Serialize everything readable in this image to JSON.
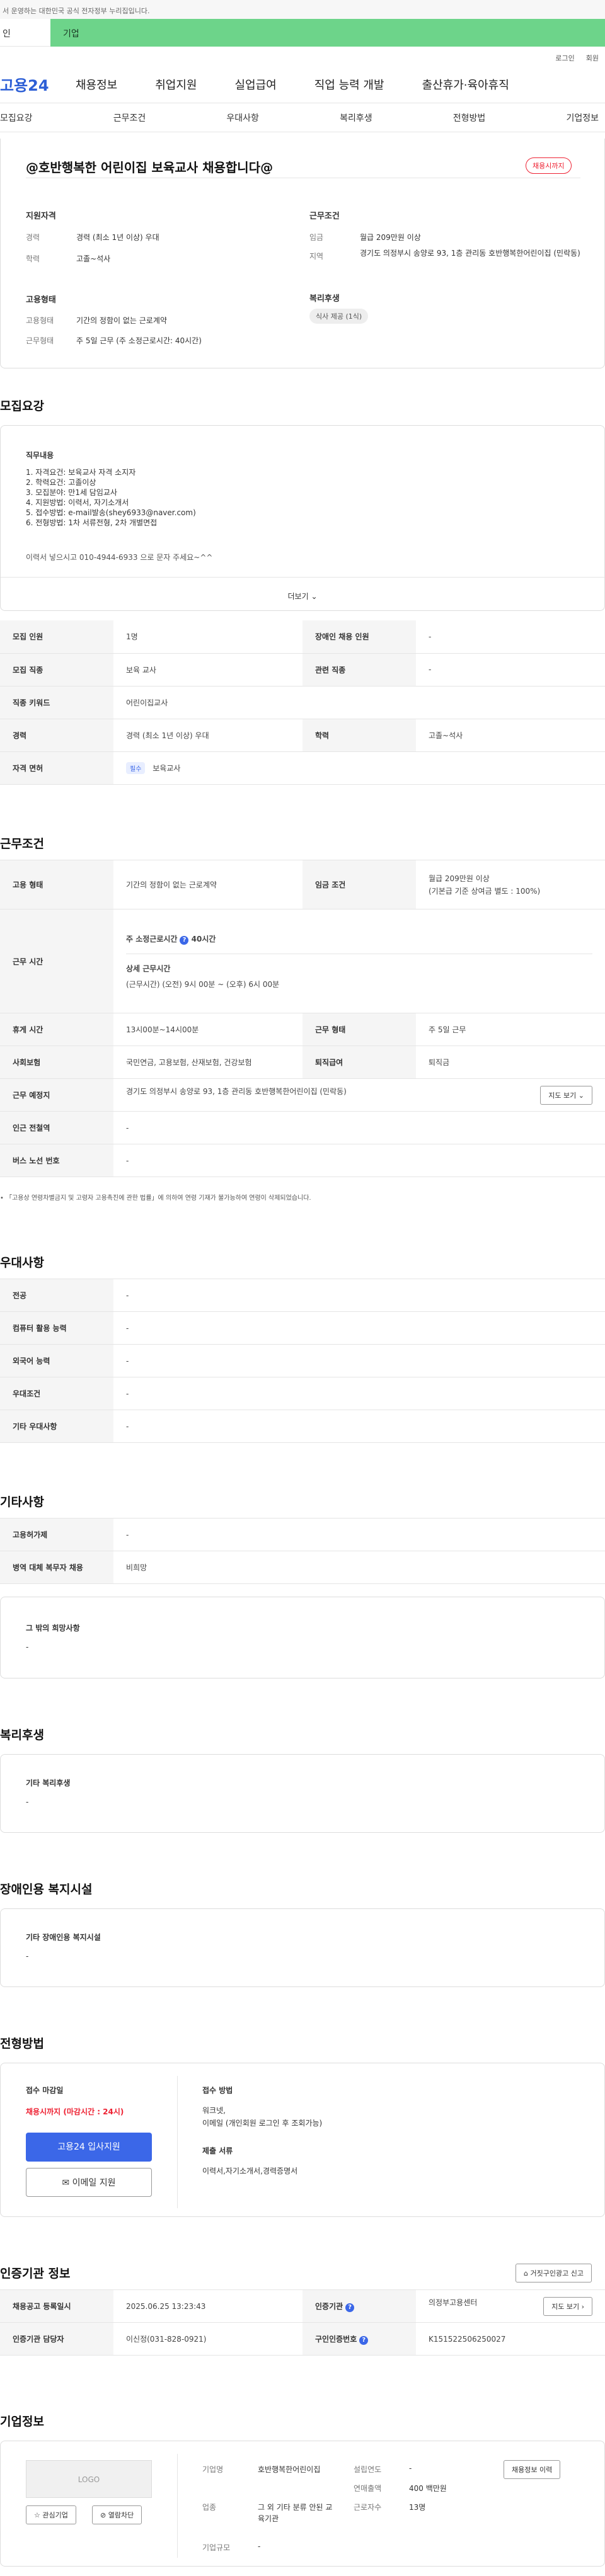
{
  "top_notice": "서 운영하는 대한민국 공식 전자정부 누리집입니다.",
  "member_tabs": [
    "인",
    "기업"
  ],
  "util": [
    "로그인",
    "회원"
  ],
  "logo": "고용24",
  "gnb": [
    "채용정보",
    "취업지원",
    "실업급여",
    "직업 능력 개발",
    "출산휴가·육아휴직"
  ],
  "subnav": [
    "모집요강",
    "근무조건",
    "우대사항",
    "복리후생",
    "전형방법",
    "기업정보"
  ],
  "header": {
    "title": "@호반행복한 어린이집 보육교사 채용합니다@",
    "status_badge": "채용시까지",
    "qual_title": "지원자격",
    "qual": [
      {
        "k": "경력",
        "v": "경력 (최소 1년 이상) 우대"
      },
      {
        "k": "학력",
        "v": "고졸~석사"
      }
    ],
    "cond_title": "근무조건",
    "cond": [
      {
        "k": "임금",
        "v": "월급 209만원 이상"
      },
      {
        "k": "지역",
        "v": "경기도 의정부시 송양로 93, 1층 관리동 호반행복한어린이집 (민락동)"
      }
    ],
    "emp_title": "고용형태",
    "emp": [
      {
        "k": "고용형태",
        "v": "기간의 정함이 없는 근로계약"
      },
      {
        "k": "근무형태",
        "v": "주 5일 근무 (주 소정근로시간: 40시간)"
      }
    ],
    "welfare_title": "복리후생",
    "welfare_chip": "식사 제공 (1식)"
  },
  "recruit": {
    "section_title": "모집요강",
    "duty_title": "직무내용",
    "duty_lines": [
      "1. 자격요건: 보육교사 자격 소지자",
      "2. 학력요건: 고졸이상",
      "3. 모집분야: 만1세 담임교사",
      "4. 지원방법: 이력서, 자기소개서",
      "5. 접수방법: e-mail발송(shey6933@naver.com)",
      "6. 전형방법: 1차 서류전형, 2차 개별면접"
    ],
    "duty_extra": "이력서 넣으시고 010-4944-6933 으로 문자 주세요~^^",
    "more": "더보기",
    "rows": [
      [
        {
          "h": "모집 인원",
          "v": "1명"
        },
        {
          "h": "장애인 채용 인원",
          "v": "-"
        }
      ],
      [
        {
          "h": "모집 직종",
          "v": "보육 교사"
        },
        {
          "h": "관련 직종",
          "v": "-"
        }
      ],
      [
        {
          "h": "직종 키워드",
          "v": "어린이집교사"
        }
      ],
      [
        {
          "h": "경력",
          "v": "경력 (최소 1년 이상) 우대"
        },
        {
          "h": "학력",
          "v": "고졸~석사"
        }
      ]
    ],
    "license_h": "자격 면허",
    "license_chip": "필수",
    "license_v": "보육교사"
  },
  "work": {
    "section_title": "근무조건",
    "emp_h": "고용 형태",
    "emp_v": "기간의 정함이 없는 근로계약",
    "wage_h": "임금 조건",
    "wage_v1": "월급 209만원 이상",
    "wage_v2": "(기본급 기준 상여금 별도 : 100%)",
    "hours_h": "근무 시간",
    "hours_main_label": "주 소정근로시간",
    "hours_main_value": "40시간",
    "hours_detail_title": "상세 근무시간",
    "hours_detail": "(근무시간) (오전) 9시 00분 ~ (오후) 6시 00분",
    "break_h": "휴게 시간",
    "break_v": "13시00분~14시00분",
    "type_h": "근무 형태",
    "type_v": "주 5일 근무",
    "ins_h": "사회보험",
    "ins_v": "국민연금, 고용보험, 산재보험, 건강보험",
    "sev_h": "퇴직급여",
    "sev_v": "퇴직금",
    "place_h": "근무 예정지",
    "place_v": "경기도 의정부시 송양로 93, 1층 관리동 호반행복한어린이집 (민락동)",
    "map_btn": "지도 보기",
    "station_h": "인근 전철역",
    "station_v": "-",
    "bus_h": "버스 노선 번호",
    "bus_v": "-",
    "note": "「고용상 연령차별금지 및 고령자 고용촉진에 관한 법률」에 의하여 연령 기재가 불가능하여 연령이 삭제되었습니다."
  },
  "pref": {
    "section_title": "우대사항",
    "rows": [
      {
        "h": "전공",
        "v": "-"
      },
      {
        "h": "컴퓨터 활용 능력",
        "v": "-"
      },
      {
        "h": "외국어 능력",
        "v": "-"
      },
      {
        "h": "우대조건",
        "v": "-"
      },
      {
        "h": "기타 우대사항",
        "v": "-"
      }
    ]
  },
  "etc": {
    "section_title": "기타사항",
    "rows": [
      {
        "h": "고용허가제",
        "v": "-"
      },
      {
        "h": "병역 대체 복무자 채용",
        "v": "비희망"
      }
    ],
    "box_title": "그 밖의 희망사항",
    "box_v": "-"
  },
  "welfare": {
    "section_title": "복리후생",
    "box_title": "기타 복리후생",
    "box_v": "-"
  },
  "disabled": {
    "section_title": "장애인용 복지시설",
    "box_title": "기타 장애인용 복지시설",
    "box_v": "-"
  },
  "process": {
    "section_title": "전형방법",
    "deadline_title": "접수 마감일",
    "deadline_v": "채용시까지 (마감시간 : 24시)",
    "apply_btn": "고용24 입사지원",
    "email_btn": "이메일 지원",
    "method_title": "접수 방법",
    "method_v1": "워크넷,",
    "method_v2": "이메일 (개인회원 로그인 후 조회가능)",
    "docs_title": "제출 서류",
    "docs_v": "이력서,자기소개서,경력증명서"
  },
  "cert": {
    "section_title": "인증기관 정보",
    "report_btn": "거짓구인광고 신고",
    "rows": [
      [
        {
          "h": "채용공고 등록일시",
          "v": "2025.06.25 13:23:43"
        },
        {
          "h": "인증기관",
          "v": "의정부고용센터"
        }
      ],
      [
        {
          "h": "인증기관 담당자",
          "v": "이신정(031-828-0921)"
        },
        {
          "h": "구인인증번호",
          "v": "K151522506250027"
        }
      ]
    ],
    "map_btn": "지도 보기"
  },
  "company": {
    "section_title": "기업정보",
    "logo_text": "LOGO",
    "fav_btn": "관심기업",
    "block_btn": "열람차단",
    "history_btn": "채용정보 이력",
    "name_h": "기업명",
    "name_v": "호반행복한어린이집",
    "ind_h": "업종",
    "ind_v": "그 외 기타 분류 안된 교육기관",
    "size_h": "기업규모",
    "size_v": "-",
    "found_h": "설립연도",
    "found_v": "-",
    "sales_h": "연매출액",
    "sales_v": "400 백만원",
    "emp_h": "근로자수",
    "emp_v": "13명"
  }
}
